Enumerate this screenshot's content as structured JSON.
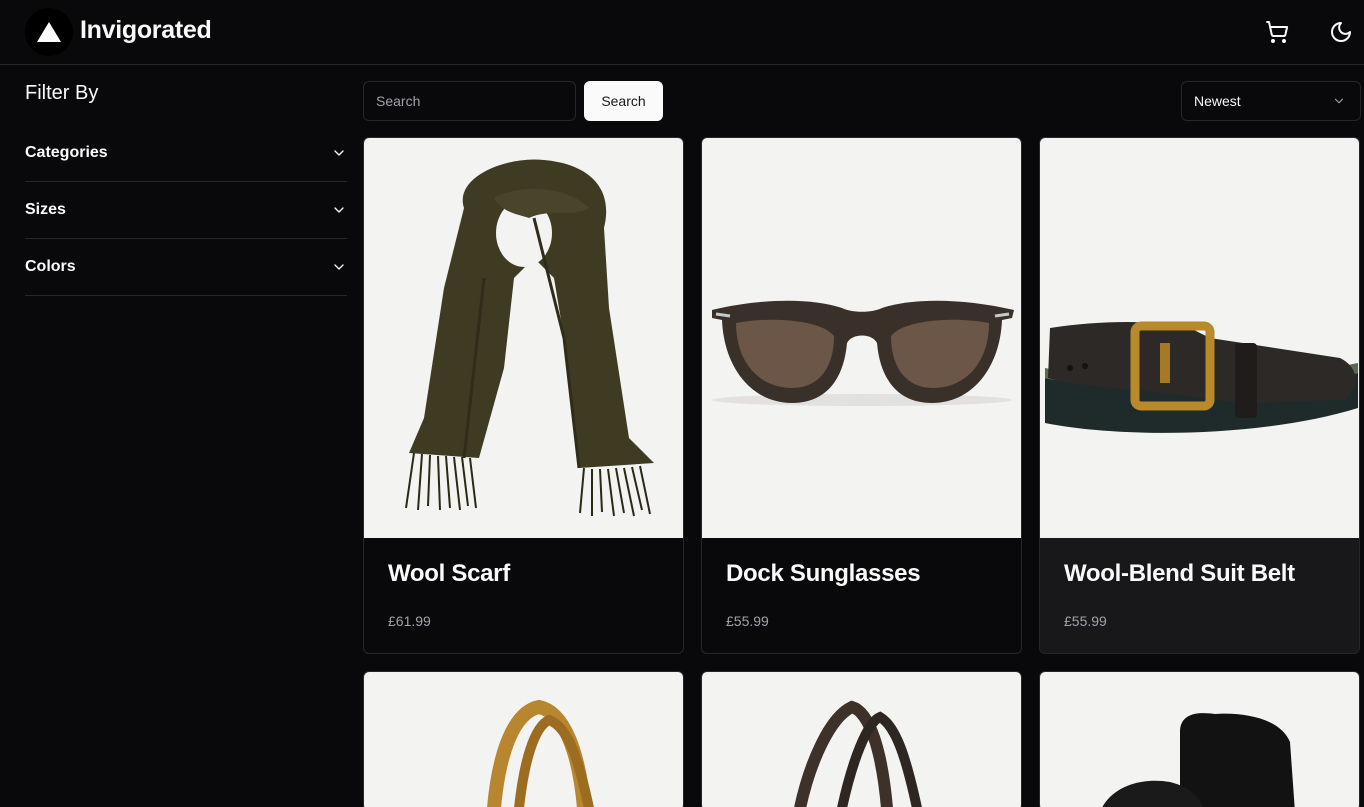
{
  "header": {
    "brand": "Invigorated",
    "icons": [
      "logo-triangle-icon",
      "cart-icon",
      "moon-icon"
    ]
  },
  "sidebar": {
    "title": "Filter By",
    "filters": [
      {
        "label": "Categories"
      },
      {
        "label": "Sizes"
      },
      {
        "label": "Colors"
      }
    ]
  },
  "toolbar": {
    "search_placeholder": "Search",
    "search_label": "Search",
    "sort_value": "Newest"
  },
  "products": [
    {
      "name": "Wool Scarf",
      "price": "£61.99"
    },
    {
      "name": "Dock Sunglasses",
      "price": "£55.99"
    },
    {
      "name": "Wool-Blend Suit Belt",
      "price": "£55.99"
    }
  ],
  "colors": {
    "background": "#09090b",
    "border": "#27272a",
    "muted": "#a1a1aa",
    "card_image_bg": "#f3f3f2"
  }
}
